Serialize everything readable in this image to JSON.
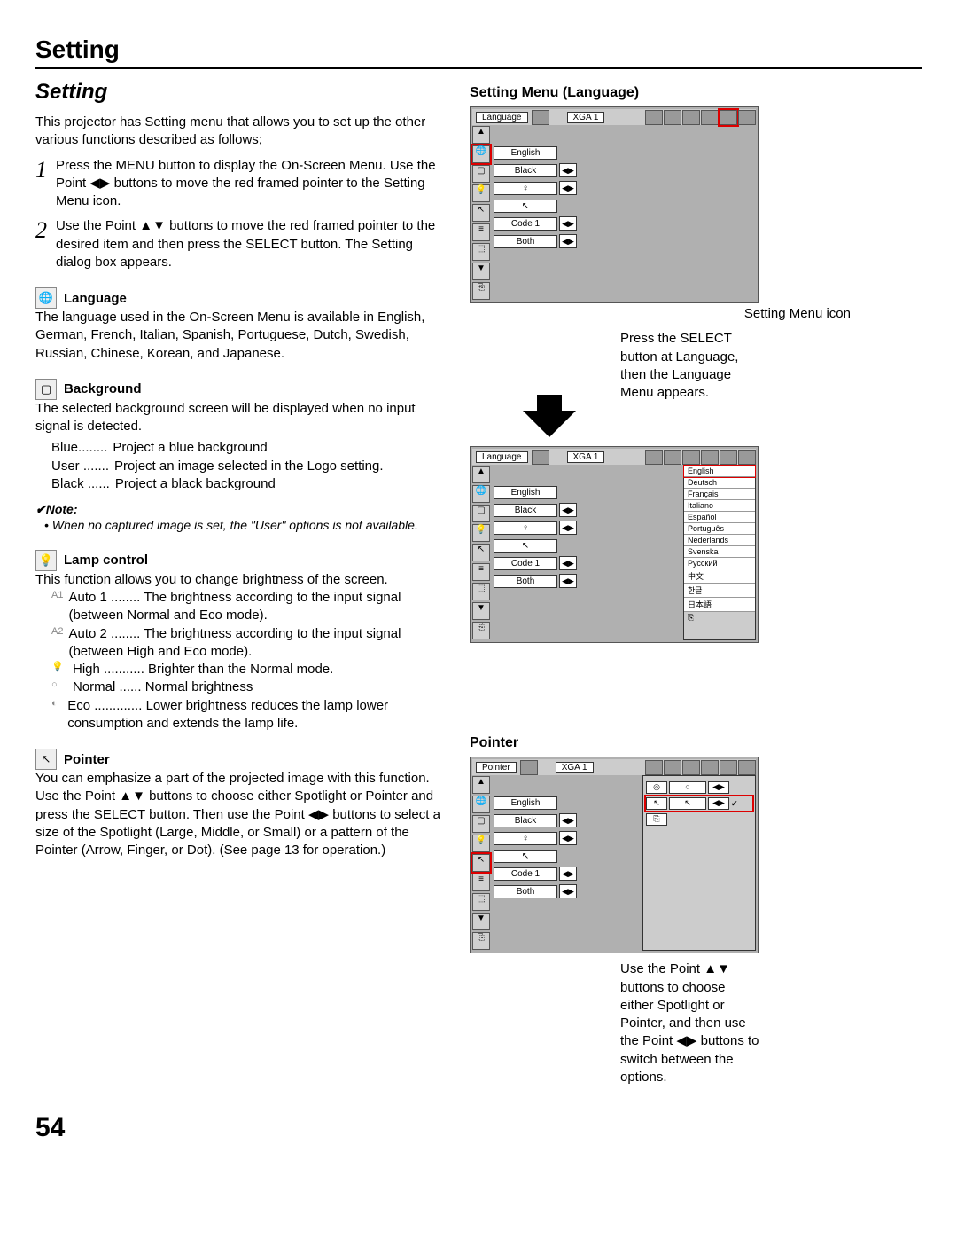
{
  "header": "Setting",
  "title": "Setting",
  "intro": "This projector has Setting menu that allows you to set up the other various functions described as follows;",
  "steps": [
    {
      "num": "1",
      "text": "Press the MENU button to display the On-Screen Menu. Use the Point ◀▶ buttons to move the red framed pointer to the Setting Menu icon."
    },
    {
      "num": "2",
      "text": "Use the Point ▲▼ buttons to move the red framed pointer to the desired item and then press the SELECT button. The Setting dialog box appears."
    }
  ],
  "sections": {
    "language": {
      "title": "Language",
      "text": "The language used in the On-Screen Menu is available in English, German, French, Italian, Spanish, Portuguese, Dutch, Swedish, Russian, Chinese, Korean, and Japanese."
    },
    "background": {
      "title": "Background",
      "text": "The selected background screen will be displayed when no input signal is detected.",
      "items": [
        {
          "k": "Blue........",
          "v": "Project a blue background"
        },
        {
          "k": "User .......",
          "v": "Project an image selected in the Logo setting."
        },
        {
          "k": "Black ......",
          "v": "Project a black background"
        }
      ],
      "note_head": "✔Note:",
      "note": "• When no captured image is set, the \"User\" options is not available."
    },
    "lamp": {
      "title": "Lamp control",
      "text": "This function allows you to change brightness of the screen.",
      "items": [
        {
          "icon": "A1",
          "k": "Auto 1 ........",
          "v": "The brightness according to the input signal (between Normal and Eco mode)."
        },
        {
          "icon": "A2",
          "k": "Auto 2 ........",
          "v": "The brightness according to the input signal (between High and Eco mode)."
        },
        {
          "icon": "💡",
          "k": "High ...........",
          "v": "Brighter than the Normal mode."
        },
        {
          "icon": "○",
          "k": "Normal  ......",
          "v": "Normal brightness"
        },
        {
          "icon": "◐",
          "k": "Eco .............",
          "v": "Lower brightness reduces the lamp lower consumption and extends the lamp life."
        }
      ]
    },
    "pointer": {
      "title": "Pointer",
      "text": "You can emphasize a part of the projected image with this function. Use the Point ▲▼ buttons to choose either Spotlight or Pointer and press the SELECT button. Then use the Point ◀▶ buttons to select a size of the Spotlight (Large, Middle, or Small) or a pattern of the Pointer (Arrow, Finger, or Dot). (See page 13 for operation.)"
    }
  },
  "right": {
    "h1": "Setting Menu (Language)",
    "cap1": "Setting Menu icon",
    "cap2": "Press the SELECT button at Language, then the Language Menu appears.",
    "menu_top": "Language",
    "xga": "XGA 1",
    "rows": [
      "English",
      "Black",
      "",
      "",
      "Code 1",
      "Both"
    ],
    "langs": [
      "English",
      "Deutsch",
      "Français",
      "Italiano",
      "Español",
      "Português",
      "Nederlands",
      "Svenska",
      "Русский",
      "中文",
      "한글",
      "日本語"
    ],
    "h2": "Pointer",
    "pointer_top": "Pointer",
    "cap3": "Use the Point ▲▼ buttons to choose either Spotlight or Pointer, and then use the Point ◀▶ buttons to switch between the options."
  },
  "pagenum": "54"
}
